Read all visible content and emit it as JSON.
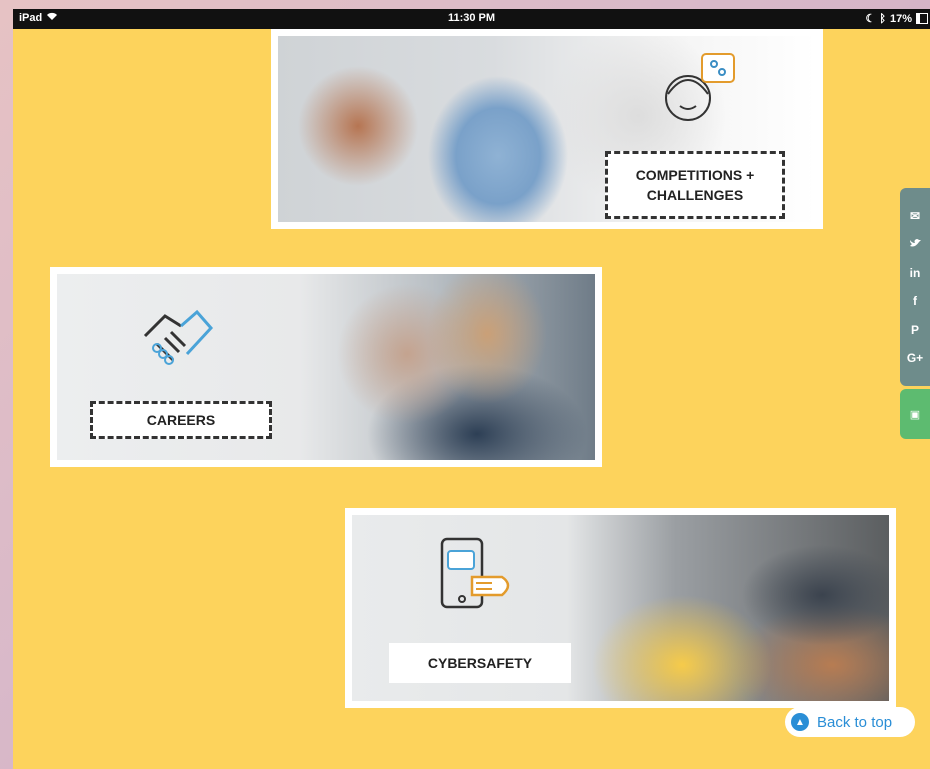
{
  "status_bar": {
    "device": "iPad",
    "time": "11:30 PM",
    "battery": "17%"
  },
  "cards": {
    "competitions": {
      "line1": "COMPETITIONS +",
      "line2": "CHALLENGES",
      "icon": "person-icon"
    },
    "careers": {
      "label": "CAREERS",
      "icon": "handshake-icon"
    },
    "cybersafety": {
      "label": "CYBERSAFETY",
      "icon": "tablet-icon"
    }
  },
  "social": {
    "email": "✉",
    "twitter": "🐦",
    "linkedin": "in",
    "facebook": "f",
    "pinterest": "P",
    "googleplus": "G+"
  },
  "back_to_top": {
    "label": "Back to top"
  },
  "colors": {
    "page_bg": "#fdd35c",
    "social_bar": "#6e8c8b",
    "green_tab": "#5dbb70",
    "link": "#2a8ed6"
  }
}
